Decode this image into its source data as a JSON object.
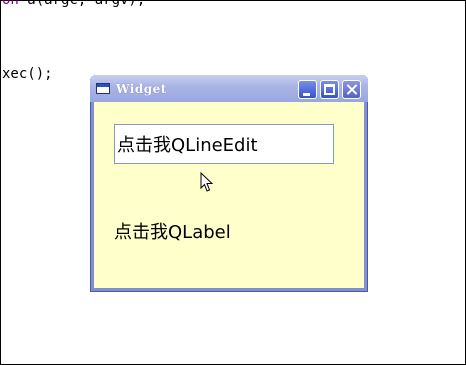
{
  "editor": {
    "line1_keyword": "on",
    "line1_rest": " a(argc, argv);",
    "line2": "xec();"
  },
  "window": {
    "title": "Widget",
    "line_edit_value": "点击我QLineEdit",
    "label_text": "点击我QLabel"
  },
  "icons": {
    "app": "window-icon",
    "minimize": "minimize-icon",
    "maximize": "maximize-icon",
    "close": "close-icon",
    "cursor": "mouse-cursor-icon"
  },
  "colors": {
    "client_background": "#ffffcc",
    "titlebar": "#9aa6e0",
    "keyword": "#800080"
  }
}
